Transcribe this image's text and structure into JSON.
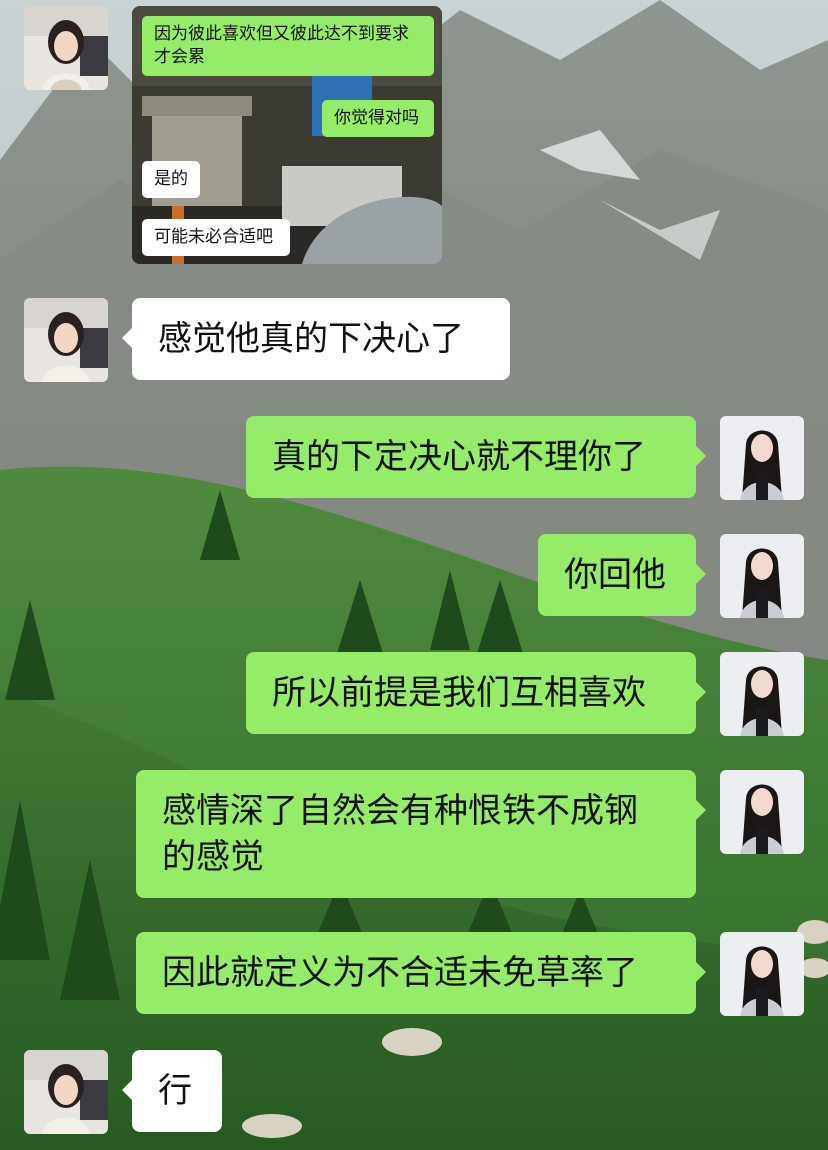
{
  "embedded_screenshot": {
    "messages": [
      {
        "side": "right",
        "text": "因为彼此喜欢但又彼此达不到要求才会累"
      },
      {
        "side": "right",
        "text": "你觉得对吗"
      },
      {
        "side": "left",
        "text": "是的"
      },
      {
        "side": "left",
        "text": "可能未必合适吧"
      }
    ]
  },
  "messages": [
    {
      "side": "left",
      "avatar": "woman-avatar",
      "text": "感觉他真的下决心了"
    },
    {
      "side": "right",
      "avatar": "self-avatar",
      "text": "真的下定决心就不理你了"
    },
    {
      "side": "right",
      "avatar": "self-avatar",
      "text": "你回他"
    },
    {
      "side": "right",
      "avatar": "self-avatar",
      "text": "所以前提是我们互相喜欢"
    },
    {
      "side": "right",
      "avatar": "self-avatar",
      "text": "感情深了自然会有种恨铁不成钢的感觉"
    },
    {
      "side": "right",
      "avatar": "self-avatar",
      "text": "因此就定义为不合适未免草率了"
    },
    {
      "side": "left",
      "avatar": "woman-avatar",
      "text": "行"
    }
  ],
  "colors": {
    "sent_bubble": "#95ec69",
    "received_bubble": "#ffffff"
  }
}
